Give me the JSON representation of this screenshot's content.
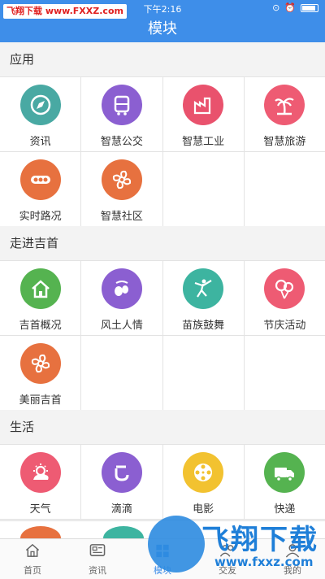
{
  "status_bar": {
    "time": "下午2:16",
    "watermark": "飞翔下载 www.FXXZ.com"
  },
  "title": "模块",
  "sections": [
    {
      "name": "应用",
      "items": [
        {
          "label": "资讯",
          "icon": "compass-icon",
          "color": "#49a9a3"
        },
        {
          "label": "智慧公交",
          "icon": "bus-icon",
          "color": "#8b5fd1"
        },
        {
          "label": "智慧工业",
          "icon": "factory-icon",
          "color": "#e9526d"
        },
        {
          "label": "智慧旅游",
          "icon": "palm-tree-icon",
          "color": "#ee5b73"
        },
        {
          "label": "实时路况",
          "icon": "traffic-light-icon",
          "color": "#e7713f"
        },
        {
          "label": "智慧社区",
          "icon": "pinwheel-icon",
          "color": "#e7713f"
        }
      ]
    },
    {
      "name": "走进吉首",
      "items": [
        {
          "label": "吉首概况",
          "icon": "home-icon",
          "color": "#55b350"
        },
        {
          "label": "风土人情",
          "icon": "olive-icon",
          "color": "#8b5fd1"
        },
        {
          "label": "苗族鼓舞",
          "icon": "dancer-icon",
          "color": "#3db4a0"
        },
        {
          "label": "节庆活动",
          "icon": "balloons-icon",
          "color": "#ee5b73"
        },
        {
          "label": "美丽吉首",
          "icon": "pinwheel-icon",
          "color": "#e7713f"
        }
      ]
    },
    {
      "name": "生活",
      "items": [
        {
          "label": "天气",
          "icon": "weather-icon",
          "color": "#ee5b73"
        },
        {
          "label": "滴滴",
          "icon": "didi-icon",
          "color": "#8b5fd1"
        },
        {
          "label": "电影",
          "icon": "film-reel-icon",
          "color": "#f2c230"
        },
        {
          "label": "快递",
          "icon": "truck-icon",
          "color": "#55b350"
        }
      ]
    }
  ],
  "tabbar": [
    {
      "label": "首页",
      "icon": "home-icon",
      "active": false
    },
    {
      "label": "资讯",
      "icon": "news-icon",
      "active": false
    },
    {
      "label": "模块",
      "icon": "module-icon",
      "active": true
    },
    {
      "label": "交友",
      "icon": "friends-icon",
      "active": false
    },
    {
      "label": "我的",
      "icon": "profile-icon",
      "active": false
    }
  ],
  "overlay_logo": {
    "text": "飞翔下载",
    "url": "www.fxxz.com"
  }
}
